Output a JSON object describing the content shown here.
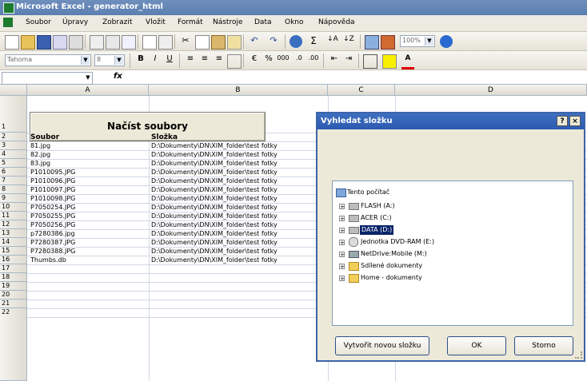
{
  "window": {
    "title": "Microsoft Excel - generator_html"
  },
  "menu": [
    "Soubor",
    "Úpravy",
    "Zobrazit",
    "Vložit",
    "Formát",
    "Nástroje",
    "Data",
    "Okno",
    "Nápověda"
  ],
  "toolbar": {
    "zoom": "100%",
    "font": "Tahoma",
    "font_size": "8"
  },
  "formula_bar": {
    "fx": "fx"
  },
  "columns": [
    "A",
    "B",
    "C",
    "D"
  ],
  "rows": [
    "1",
    "2",
    "3",
    "4",
    "5",
    "6",
    "7",
    "8",
    "9",
    "10",
    "11",
    "12",
    "13",
    "14",
    "15",
    "16",
    "17",
    "18",
    "19",
    "20",
    "21",
    "22"
  ],
  "sheet": {
    "load_button": "Načíst soubory",
    "headers": {
      "file": "Soubor",
      "folder": "Složka"
    },
    "files": [
      "81.jpg",
      "82.jpg",
      "83.jpg",
      "P1010095.JPG",
      "P1010096.JPG",
      "P1010097.JPG",
      "P1010098.JPG",
      "P7050254.JPG",
      "P7050255.JPG",
      "P7050256.JPG",
      "p7280386.jpg",
      "P7280387.JPG",
      "P7280388.JPG",
      "Thumbs.db"
    ],
    "folder_value": "D:\\Dokumenty\\DN\\XIM_folder\\test fotky"
  },
  "dialog": {
    "title": "Vyhledat složku",
    "help": "?",
    "close": "×",
    "tree": [
      {
        "label": "Tento počítač",
        "icon": "computer-icon"
      },
      {
        "label": "FLASH (A:)",
        "icon": "drive-icon"
      },
      {
        "label": "ACER (C:)",
        "icon": "drive-icon"
      },
      {
        "label": "DATA (D:)",
        "icon": "drive-icon"
      },
      {
        "label": "Jednotka DVD-RAM (E:)",
        "icon": "dvd-drive-icon"
      },
      {
        "label": "NetDrive:Mobile (M:)",
        "icon": "network-drive-icon"
      },
      {
        "label": "Sdílené dokumenty",
        "icon": "folder-icon"
      },
      {
        "label": "Home - dokumenty",
        "icon": "folder-icon"
      }
    ],
    "new_folder": "Vytvořit novou složku",
    "ok": "OK",
    "cancel": "Storno"
  }
}
